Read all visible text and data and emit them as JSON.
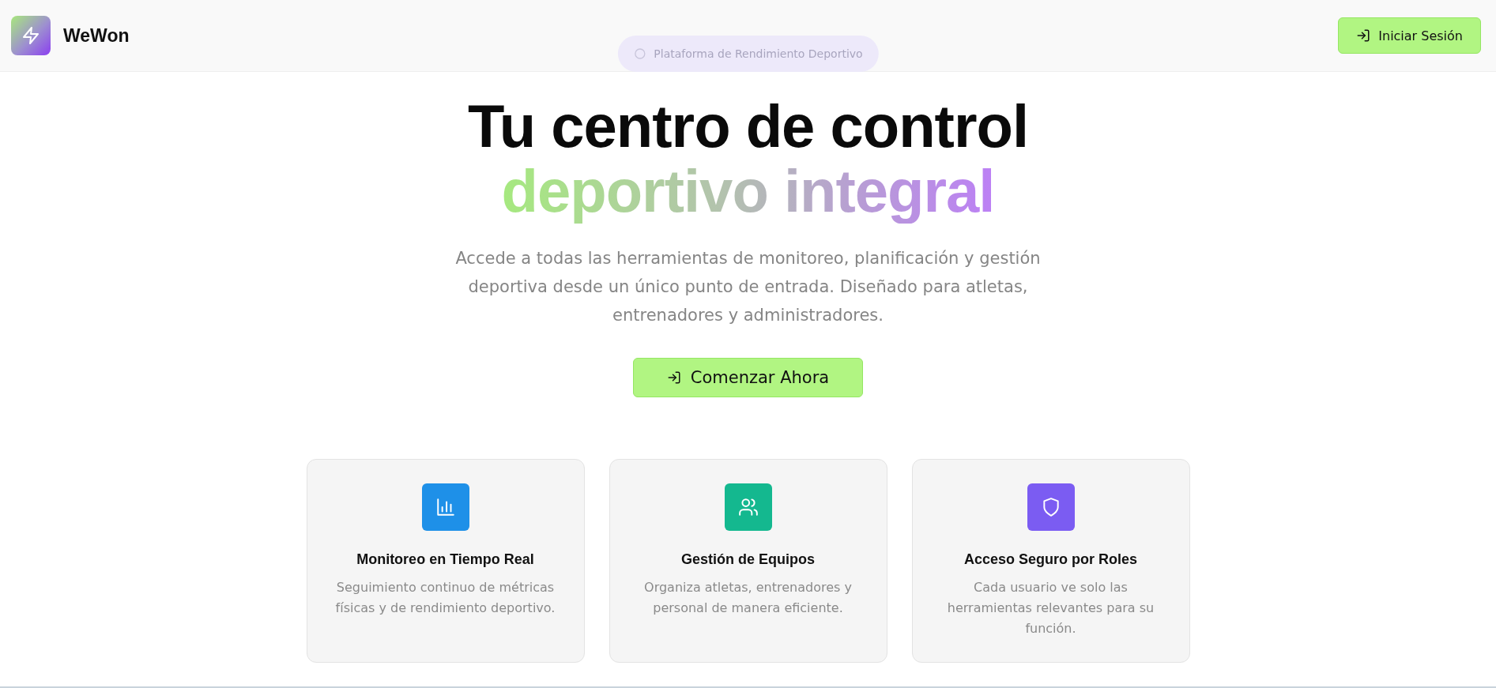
{
  "header": {
    "brand": "WeWon",
    "login_button": "Iniciar Sesión"
  },
  "badge": "Plataforma de Rendimiento Deportivo",
  "hero": {
    "title_line_1": "Tu centro de control",
    "title_line_2": "deportivo integral",
    "description": "Accede a todas las herramientas de monitoreo, planificación y gestión deportiva desde un único punto de entrada. Diseñado para atletas, entrenadores y administradores.",
    "cta_button": "Comenzar Ahora"
  },
  "features": [
    {
      "kind": "chart",
      "color": "#1e90e8",
      "title": "Monitoreo en Tiempo Real",
      "description": "Seguimiento continuo de métricas físicas y de rendimiento deportivo."
    },
    {
      "kind": "users",
      "color": "#14b88f",
      "title": "Gestión de Equipos",
      "description": "Organiza atletas, entrenadores y personal de manera eficiente."
    },
    {
      "kind": "shield",
      "color": "#7b5cf2",
      "title": "Acceso Seguro por Roles",
      "description": "Cada usuario ve solo las herramientas relevantes para su función."
    }
  ]
}
